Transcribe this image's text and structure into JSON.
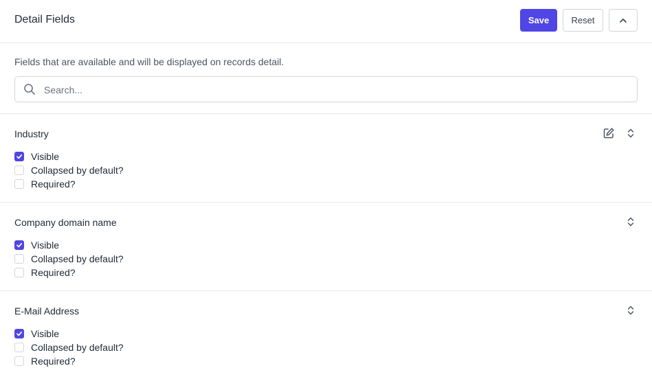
{
  "header": {
    "title": "Detail Fields",
    "save_label": "Save",
    "reset_label": "Reset"
  },
  "description": "Fields that are available and will be displayed on records detail.",
  "search": {
    "placeholder": "Search...",
    "value": ""
  },
  "colors": {
    "accent": "#4f46e5",
    "border": "#e5e7eb",
    "text": "#1f2937",
    "muted": "#4b5563"
  },
  "fields": [
    {
      "name": "Industry",
      "editable": true,
      "options": [
        {
          "label": "Visible",
          "checked": true
        },
        {
          "label": "Collapsed by default?",
          "checked": false
        },
        {
          "label": "Required?",
          "checked": false
        }
      ]
    },
    {
      "name": "Company domain name",
      "editable": false,
      "options": [
        {
          "label": "Visible",
          "checked": true
        },
        {
          "label": "Collapsed by default?",
          "checked": false
        },
        {
          "label": "Required?",
          "checked": false
        }
      ]
    },
    {
      "name": "E-Mail Address",
      "editable": false,
      "options": [
        {
          "label": "Visible",
          "checked": true
        },
        {
          "label": "Collapsed by default?",
          "checked": false
        },
        {
          "label": "Required?",
          "checked": false
        }
      ]
    }
  ]
}
